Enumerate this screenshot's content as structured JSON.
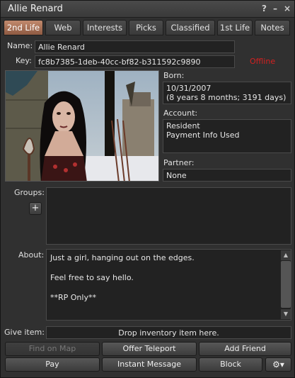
{
  "window": {
    "title": "Allie Renard",
    "help_label": "?",
    "minimize_label": "–",
    "close_label": "×"
  },
  "tabs": [
    {
      "label": "2nd Life",
      "active": true
    },
    {
      "label": "Web"
    },
    {
      "label": "Interests"
    },
    {
      "label": "Picks"
    },
    {
      "label": "Classified"
    },
    {
      "label": "1st Life"
    },
    {
      "label": "Notes"
    }
  ],
  "profile": {
    "name_label": "Name:",
    "name_value": "Allie Renard",
    "key_label": "Key:",
    "key_value": "fc8b7385-1deb-40cc-bf82-b311592c9890",
    "status": "Offline",
    "born_label": "Born:",
    "born_line1": "10/31/2007",
    "born_line2": "(8 years 8 months; 3191 days)",
    "account_label": "Account:",
    "account_line1": "Resident",
    "account_line2": "Payment Info Used",
    "partner_label": "Partner:",
    "partner_value": "None",
    "groups_label": "Groups:",
    "add_group_label": "+",
    "about_label": "About:",
    "about_lines": [
      "Just a girl, hanging out on the edges.",
      "",
      "Feel free to say hello.",
      "",
      "**RP Only**"
    ],
    "give_item_label": "Give item:",
    "drop_zone_text": "Drop inventory item here."
  },
  "buttons": {
    "find_on_map": "Find on Map",
    "offer_teleport": "Offer Teleport",
    "add_friend": "Add Friend",
    "pay": "Pay",
    "instant_message": "Instant Message",
    "block": "Block",
    "gear_icon": "gear-icon"
  },
  "colors": {
    "active_tab": "#b07a5e",
    "offline": "#d42020",
    "window_bg": "#303030"
  }
}
